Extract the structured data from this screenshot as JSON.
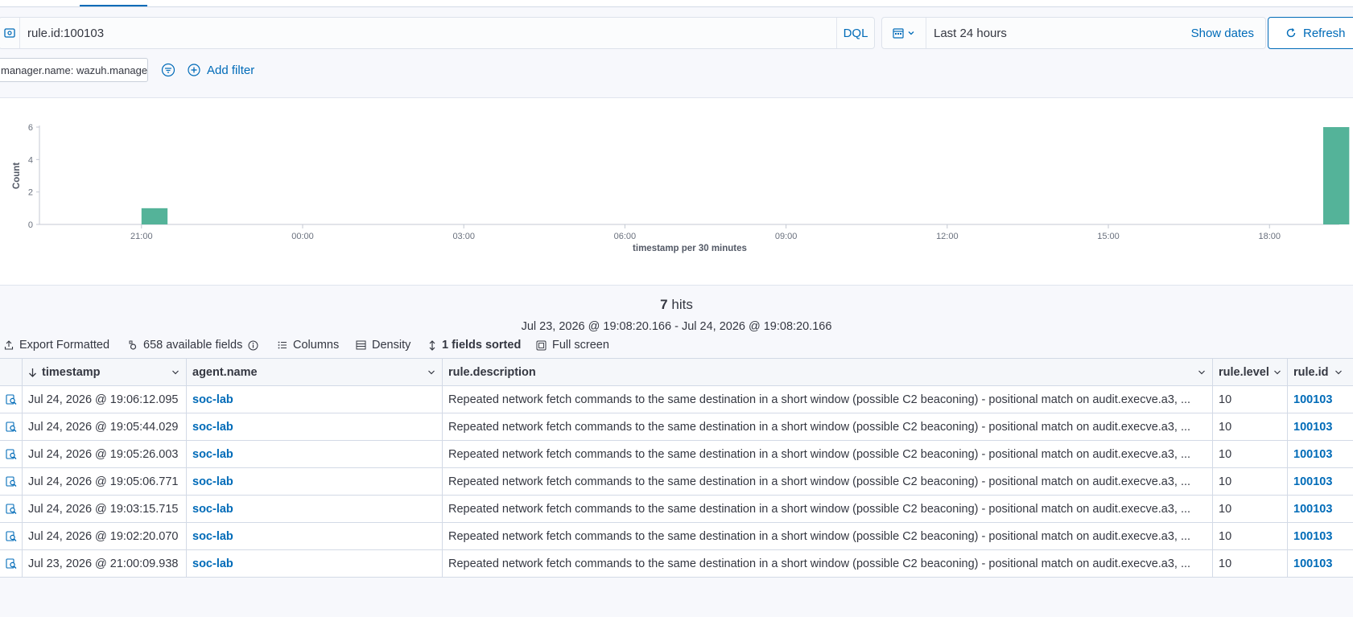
{
  "query": {
    "text": "rule.id:100103",
    "language": "DQL"
  },
  "date_picker": {
    "range": "Last 24 hours",
    "show_dates": "Show dates",
    "refresh": "Refresh"
  },
  "filters": {
    "pill": "manager.name: wazuh.manager",
    "add_filter": "Add filter"
  },
  "chart_data": {
    "type": "bar",
    "ylabel": "Count",
    "xlabel": "timestamp per 30 minutes",
    "ylim": [
      0,
      6
    ],
    "y_ticks": [
      "0",
      "2",
      "4",
      "6"
    ],
    "x_ticks": [
      "21:00",
      "00:00",
      "03:00",
      "06:00",
      "09:00",
      "12:00",
      "15:00",
      "18:00"
    ],
    "x_domain_hours": [
      19.1,
      43.3
    ],
    "bars": [
      {
        "x": "Jul 23 21:00",
        "hour": 21.0,
        "value": 1
      },
      {
        "x": "Jul 24 19:00",
        "hour": 43.0,
        "value": 6
      }
    ],
    "bar_color": "#54b399"
  },
  "summary": {
    "hits_count": "7",
    "hits_label": " hits",
    "date_range": "Jul 23, 2026 @ 19:08:20.166 - Jul 24, 2026 @ 19:08:20.166"
  },
  "toolbar": {
    "export": "Export Formatted",
    "fields": "658 available fields",
    "columns": "Columns",
    "density": "Density",
    "sorted": "1 fields sorted",
    "fullscreen": "Full screen"
  },
  "table": {
    "headers": [
      "timestamp",
      "agent.name",
      "rule.description",
      "rule.level",
      "rule.id"
    ],
    "rows": [
      [
        "Jul 24, 2026 @ 19:06:12.095",
        "soc-lab",
        "Repeated network fetch commands to the same destination in a short window (possible C2 beaconing) - positional match on audit.execve.a3, ...",
        "10",
        "100103"
      ],
      [
        "Jul 24, 2026 @ 19:05:44.029",
        "soc-lab",
        "Repeated network fetch commands to the same destination in a short window (possible C2 beaconing) - positional match on audit.execve.a3, ...",
        "10",
        "100103"
      ],
      [
        "Jul 24, 2026 @ 19:05:26.003",
        "soc-lab",
        "Repeated network fetch commands to the same destination in a short window (possible C2 beaconing) - positional match on audit.execve.a3, ...",
        "10",
        "100103"
      ],
      [
        "Jul 24, 2026 @ 19:05:06.771",
        "soc-lab",
        "Repeated network fetch commands to the same destination in a short window (possible C2 beaconing) - positional match on audit.execve.a3, ...",
        "10",
        "100103"
      ],
      [
        "Jul 24, 2026 @ 19:03:15.715",
        "soc-lab",
        "Repeated network fetch commands to the same destination in a short window (possible C2 beaconing) - positional match on audit.execve.a3, ...",
        "10",
        "100103"
      ],
      [
        "Jul 24, 2026 @ 19:02:20.070",
        "soc-lab",
        "Repeated network fetch commands to the same destination in a short window (possible C2 beaconing) - positional match on audit.execve.a3, ...",
        "10",
        "100103"
      ],
      [
        "Jul 23, 2026 @ 21:00:09.938",
        "soc-lab",
        "Repeated network fetch commands to the same destination in a short window (possible C2 beaconing) - positional match on audit.execve.a3, ...",
        "10",
        "100103"
      ]
    ]
  }
}
